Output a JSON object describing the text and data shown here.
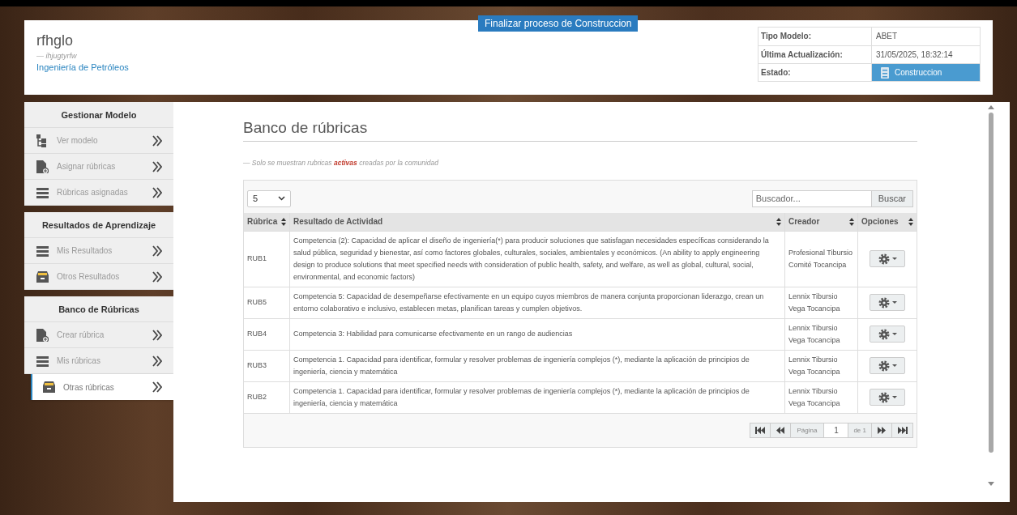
{
  "header": {
    "title": "rfhglo",
    "subtitle": "— ihjugtyrfw",
    "program": "Ingeniería de Petróleos",
    "finalize_button": "Finalizar proceso de Construccion",
    "info": [
      {
        "label": "Tipo Modelo:",
        "value": "ABET",
        "kind": "text"
      },
      {
        "label": "Última Actualización:",
        "value": "31/05/2025, 18:32:14",
        "kind": "text"
      },
      {
        "label": "Estado:",
        "value": "Construccion",
        "kind": "status"
      }
    ]
  },
  "sidebar": {
    "sections": [
      {
        "title": "Gestionar Modelo",
        "items": [
          {
            "label": "Ver modelo",
            "kind": "tree",
            "selected": false
          },
          {
            "label": "Asignar rúbricas",
            "kind": "file-add",
            "selected": false
          },
          {
            "label": "Rúbricas asignadas",
            "kind": "list",
            "selected": false
          }
        ]
      },
      {
        "title": "Resultados de Aprendizaje",
        "items": [
          {
            "label": "Mis Resultados",
            "kind": "list",
            "selected": false
          },
          {
            "label": "Otros Resultados",
            "kind": "archive",
            "selected": false
          }
        ]
      },
      {
        "title": "Banco de Rúbricas",
        "items": [
          {
            "label": "Crear rúbrica",
            "kind": "file-add",
            "selected": false
          },
          {
            "label": "Mis rúbricas",
            "kind": "list",
            "selected": false
          },
          {
            "label": "Otras rúbricas",
            "kind": "archive",
            "selected": true
          }
        ]
      }
    ]
  },
  "main": {
    "title": "Banco de rúbricas",
    "note": "— Solo se muestran rubricas **activas** creadas por la comunidad",
    "page_size": "5",
    "search": {
      "placeholder": "Buscador...",
      "button": "Buscar"
    },
    "table": {
      "columns": [
        "Rúbrica",
        "Resultado de Actividad",
        "Creador",
        "Opciones"
      ],
      "rows": [
        {
          "cells": [
            "RUB1",
            "Competencia (2): Capacidad de aplicar el diseño de ingeniería(*) para producir soluciones que satisfagan necesidades específicas considerando la salud pública, seguridad y bienestar, así como factores globales, culturales, sociales, ambientales y económicos. (An ability to apply engineering design to produce solutions that meet specified needs with consideration of public health, safety, and welfare, as well as global, cultural, social, environmental, and economic factors)",
            "Profesional Tibursio Comité Tocancipa"
          ]
        },
        {
          "cells": [
            "RUB5",
            "Competencia 5: Capacidad de desempeñarse efectivamente en un equipo cuyos miembros de manera conjunta proporcionan liderazgo, crean un entorno colaborativo e inclusivo, establecen metas, planifican tareas y cumplen objetivos.",
            "Lennix Tibursio Vega Tocancipa"
          ]
        },
        {
          "cells": [
            "RUB4",
            "Competencia 3: Habilidad para comunicarse efectivamente en un rango de audiencias",
            "Lennix Tibursio Vega Tocancipa"
          ]
        },
        {
          "cells": [
            "RUB3",
            "Competencia 1. Capacidad para identificar, formular y resolver problemas de ingeniería complejos (*), mediante la aplicación de principios de ingeniería, ciencia y matemática",
            "Lennix Tibursio Vega Tocancipa"
          ]
        },
        {
          "cells": [
            "RUB2",
            "Competencia 1. Capacidad para identificar, formular y resolver problemas de ingeniería complejos (*), mediante la aplicación de principios de ingeniería, ciencia y matemática",
            "Lennix Tibursio Vega Tocancipa"
          ]
        }
      ]
    },
    "pager": {
      "page_label": "Página",
      "page": "1",
      "of": "de 1"
    }
  }
}
